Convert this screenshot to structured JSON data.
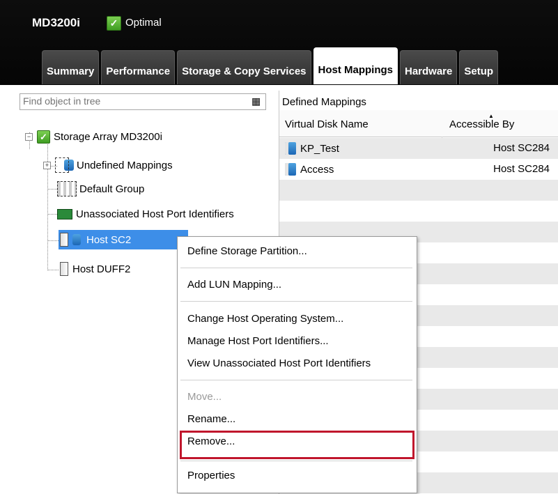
{
  "header": {
    "array_name": "MD3200i",
    "status": "Optimal",
    "tabs": [
      {
        "label": "Summary"
      },
      {
        "label": "Performance"
      },
      {
        "label": "Storage & Copy Services"
      },
      {
        "label": "Host Mappings",
        "active": true
      },
      {
        "label": "Hardware"
      },
      {
        "label": "Setup"
      }
    ]
  },
  "left": {
    "find_placeholder": "Find object in tree",
    "tree": {
      "root": "Storage Array MD3200i",
      "undefined": "Undefined Mappings",
      "default_group": "Default Group",
      "unassociated": "Unassociated Host Port Identifiers",
      "host1": "Host SC2",
      "host2": "Host DUFF2"
    }
  },
  "right": {
    "title": "Defined Mappings",
    "columns": [
      "Virtual Disk Name",
      "Accessible By"
    ],
    "rows": [
      {
        "name": "KP_Test",
        "access": "Host SC284"
      },
      {
        "name": "Access",
        "access": "Host SC284"
      }
    ]
  },
  "menu": {
    "items": [
      "Define Storage Partition...",
      "Add LUN Mapping...",
      "Change Host Operating System...",
      "Manage Host Port Identifiers...",
      "View Unassociated Host Port Identifiers",
      "Move...",
      "Rename...",
      "Remove...",
      "Properties"
    ]
  },
  "colors": {
    "selection": "#3d8ee8",
    "highlight": "#c0162c",
    "status_ok": "#4caf2a"
  }
}
